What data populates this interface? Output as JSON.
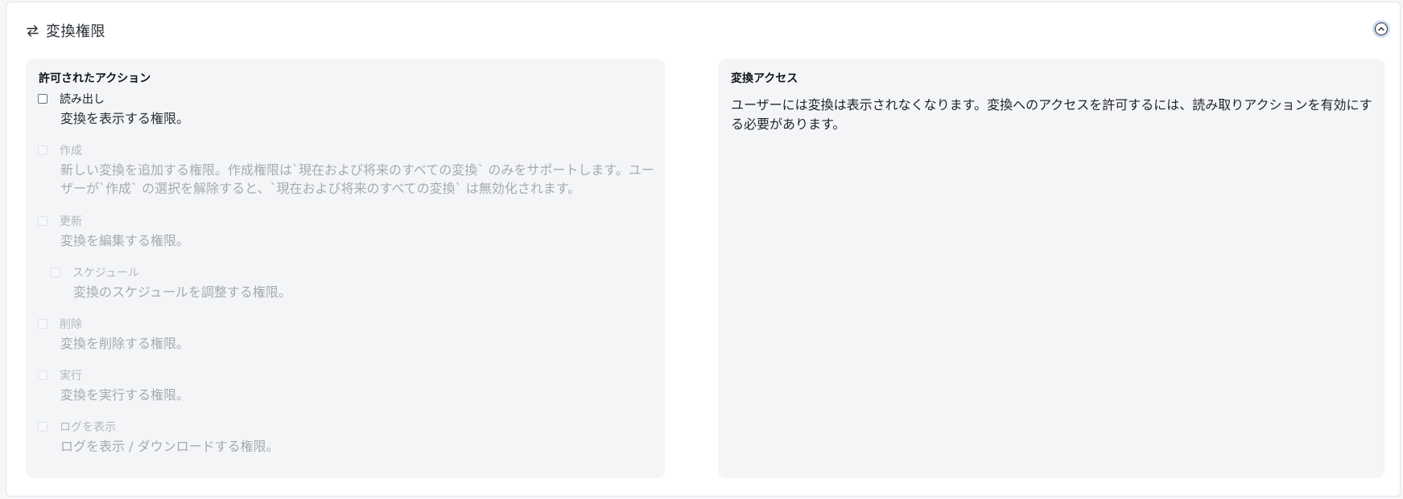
{
  "section": {
    "title": "変換権限",
    "icon": "arrows-left-right-icon",
    "collapse_icon": "chevron-up-circle-icon"
  },
  "allowed_actions": {
    "title": "許可されたアクション",
    "options": [
      {
        "label": "読み出し",
        "description": "変換を表示する権限。",
        "disabled": false,
        "checked": false
      },
      {
        "label": "作成",
        "description": "新しい変換を追加する権限。作成権限は`現在および将来のすべての変換` のみをサポートします。ユーザーが`作成` の選択を解除すると、`現在および将来のすべての変換` は無効化されます。",
        "disabled": true,
        "checked": false
      },
      {
        "label": "更新",
        "description": "変換を編集する権限。",
        "disabled": true,
        "checked": false
      },
      {
        "label": "スケジュール",
        "description": "変換のスケジュールを調整する権限。",
        "disabled": true,
        "checked": false
      },
      {
        "label": "削除",
        "description": "変換を削除する権限。",
        "disabled": true,
        "checked": false
      },
      {
        "label": "実行",
        "description": "変換を実行する権限。",
        "disabled": true,
        "checked": false
      },
      {
        "label": "ログを表示",
        "description": "ログを表示 / ダウンロードする権限。",
        "disabled": true,
        "checked": false
      }
    ]
  },
  "access": {
    "title": "変換アクセス",
    "message": "ユーザーには変換は表示されなくなります。変換へのアクセスを許可するには、読み取りアクションを有効にする必要があります。"
  },
  "colors": {
    "panel_bg": "#f4f5f7",
    "disabled_text": "#a6aab0",
    "focus_ring": "#cfdcf3"
  }
}
